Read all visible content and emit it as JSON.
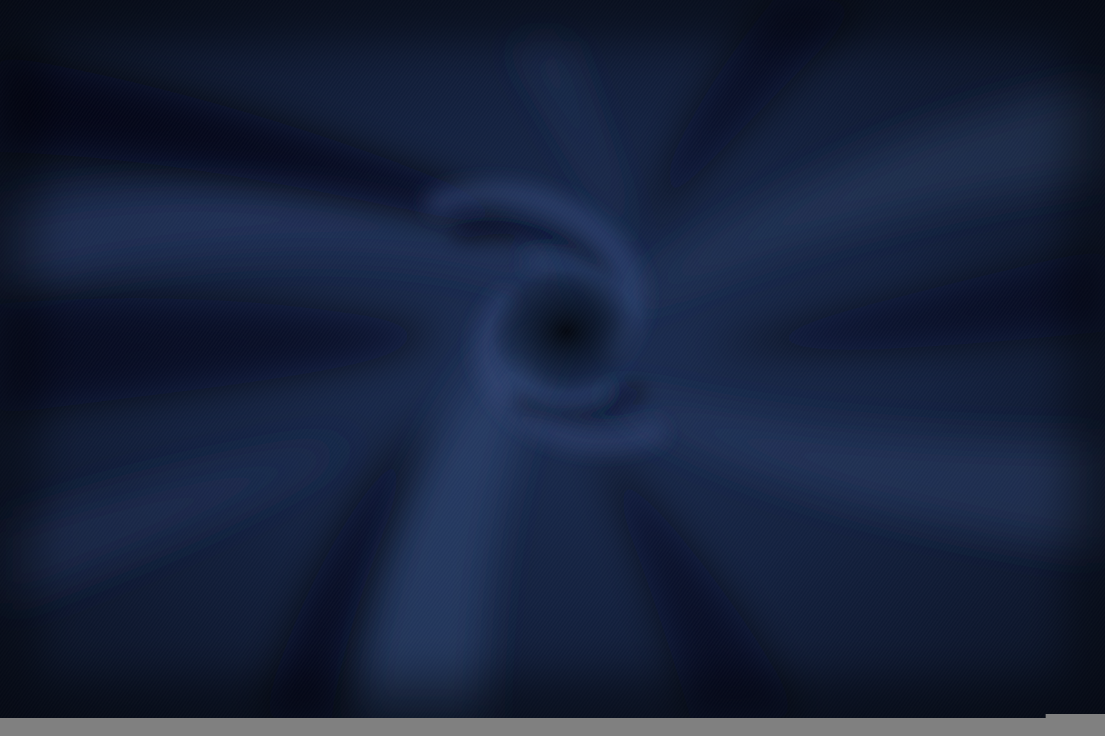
{
  "image": {
    "subject": "",
    "colors": {
      "fabric_base": "#0f1b33",
      "fabric_mid": "#1a2a4a",
      "fabric_highlight": "#2c4068",
      "fabric_shadow": "#03070f",
      "bottom_band": "#808080"
    }
  }
}
